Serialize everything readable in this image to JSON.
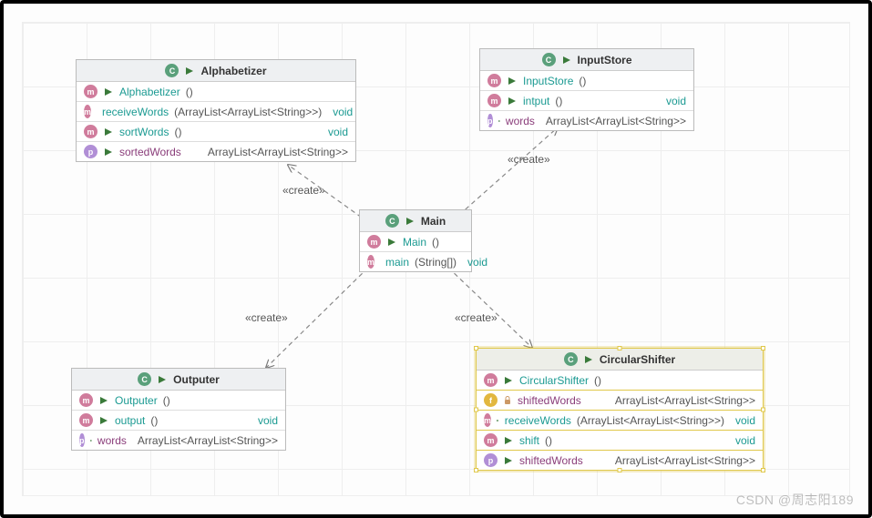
{
  "watermark": "CSDN @周志阳189",
  "edges": [
    {
      "from": "Main",
      "to": "Alphabetizer",
      "label": "«create»"
    },
    {
      "from": "Main",
      "to": "InputStore",
      "label": "«create»"
    },
    {
      "from": "Main",
      "to": "Outputer",
      "label": "«create»"
    },
    {
      "from": "Main",
      "to": "CircularShifter",
      "label": "«create»"
    }
  ],
  "classes": {
    "alphabetizer": {
      "name": "Alphabetizer",
      "members": [
        {
          "kind": "method",
          "name": "Alphabetizer",
          "params": "()",
          "returns": ""
        },
        {
          "kind": "method",
          "name": "receiveWords",
          "params": "(ArrayList<ArrayList<String>>)",
          "returns": "void"
        },
        {
          "kind": "method",
          "name": "sortWords",
          "params": "()",
          "returns": "void"
        },
        {
          "kind": "property",
          "name": "sortedWords",
          "params": "",
          "returns": "ArrayList<ArrayList<String>>"
        }
      ]
    },
    "inputstore": {
      "name": "InputStore",
      "members": [
        {
          "kind": "method",
          "name": "InputStore",
          "params": "()",
          "returns": ""
        },
        {
          "kind": "method",
          "name": "intput",
          "params": "()",
          "returns": "void"
        },
        {
          "kind": "property",
          "name": "words",
          "params": "",
          "returns": "ArrayList<ArrayList<String>>"
        }
      ]
    },
    "main": {
      "name": "Main",
      "members": [
        {
          "kind": "method",
          "name": "Main",
          "params": "()",
          "returns": ""
        },
        {
          "kind": "method",
          "name": "main",
          "params": "(String[])",
          "returns": "void"
        }
      ]
    },
    "outputer": {
      "name": "Outputer",
      "members": [
        {
          "kind": "method",
          "name": "Outputer",
          "params": "()",
          "returns": ""
        },
        {
          "kind": "method",
          "name": "output",
          "params": "()",
          "returns": "void"
        },
        {
          "kind": "property",
          "name": "words",
          "params": "",
          "returns": "ArrayList<ArrayList<String>>"
        }
      ]
    },
    "circularshifter": {
      "name": "CircularShifter",
      "selected": true,
      "members": [
        {
          "kind": "method",
          "name": "CircularShifter",
          "params": "()",
          "returns": ""
        },
        {
          "kind": "field",
          "visibility": "private",
          "name": "shiftedWords",
          "params": "",
          "returns": "ArrayList<ArrayList<String>>"
        },
        {
          "kind": "method",
          "name": "receiveWords",
          "params": "(ArrayList<ArrayList<String>>)",
          "returns": "void"
        },
        {
          "kind": "method",
          "name": "shift",
          "params": "()",
          "returns": "void"
        },
        {
          "kind": "property",
          "name": "shiftedWords",
          "params": "",
          "returns": "ArrayList<ArrayList<String>>"
        }
      ]
    }
  }
}
